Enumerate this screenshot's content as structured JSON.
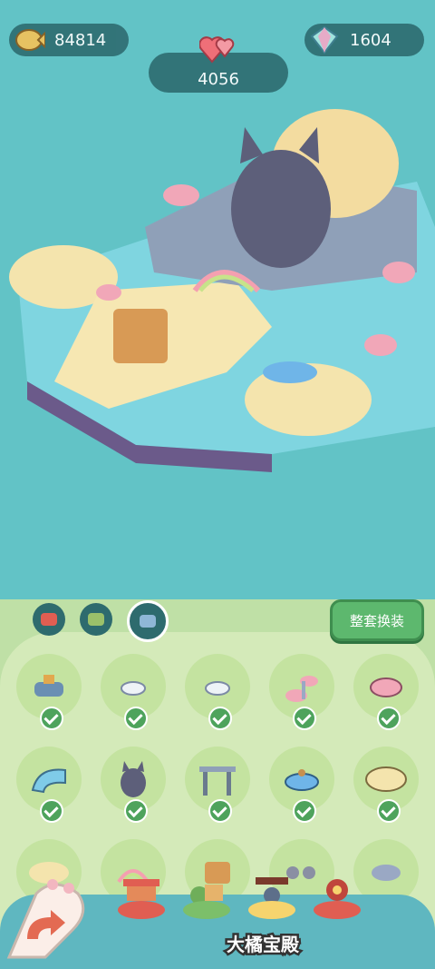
{
  "resources": {
    "gold": "84814",
    "gems": "1604",
    "hearts": "4056"
  },
  "icons": {
    "gold": "fish-coin-icon",
    "gems": "crystal-icon",
    "hearts": "double-heart-icon"
  },
  "categories": {
    "tabs": [
      {
        "name": "theme-tab-red",
        "active": false
      },
      {
        "name": "theme-tab-green",
        "active": false
      },
      {
        "name": "theme-tab-ocean",
        "active": true
      }
    ],
    "outfit_button": "整套换装"
  },
  "items": [
    {
      "name": "fountain-bench",
      "equipped": true
    },
    {
      "name": "shell-seat-small",
      "equipped": true
    },
    {
      "name": "shell-seat-small-2",
      "equipped": true
    },
    {
      "name": "shell-tree",
      "equipped": true
    },
    {
      "name": "pink-shell",
      "equipped": true
    },
    {
      "name": "water-slide",
      "equipped": true
    },
    {
      "name": "cat-statue",
      "equipped": true
    },
    {
      "name": "driftwood-arch",
      "equipped": true
    },
    {
      "name": "bubble-boat",
      "equipped": true
    },
    {
      "name": "sand-island",
      "equipped": true
    },
    {
      "name": "sand-patch",
      "equipped": false
    },
    {
      "name": "rainbow-bridge",
      "equipped": false
    },
    {
      "name": "arcade-machines",
      "equipped": false
    },
    {
      "name": "cat-group",
      "equipped": false
    },
    {
      "name": "starfish-rock",
      "equipped": false
    }
  ],
  "theme_bar": {
    "selected_label": "大橘宝殿"
  },
  "colors": {
    "sea": "#62c3c6",
    "panel": "#d4eab9",
    "accent_green": "#5db86e",
    "check": "#4ea35c"
  }
}
